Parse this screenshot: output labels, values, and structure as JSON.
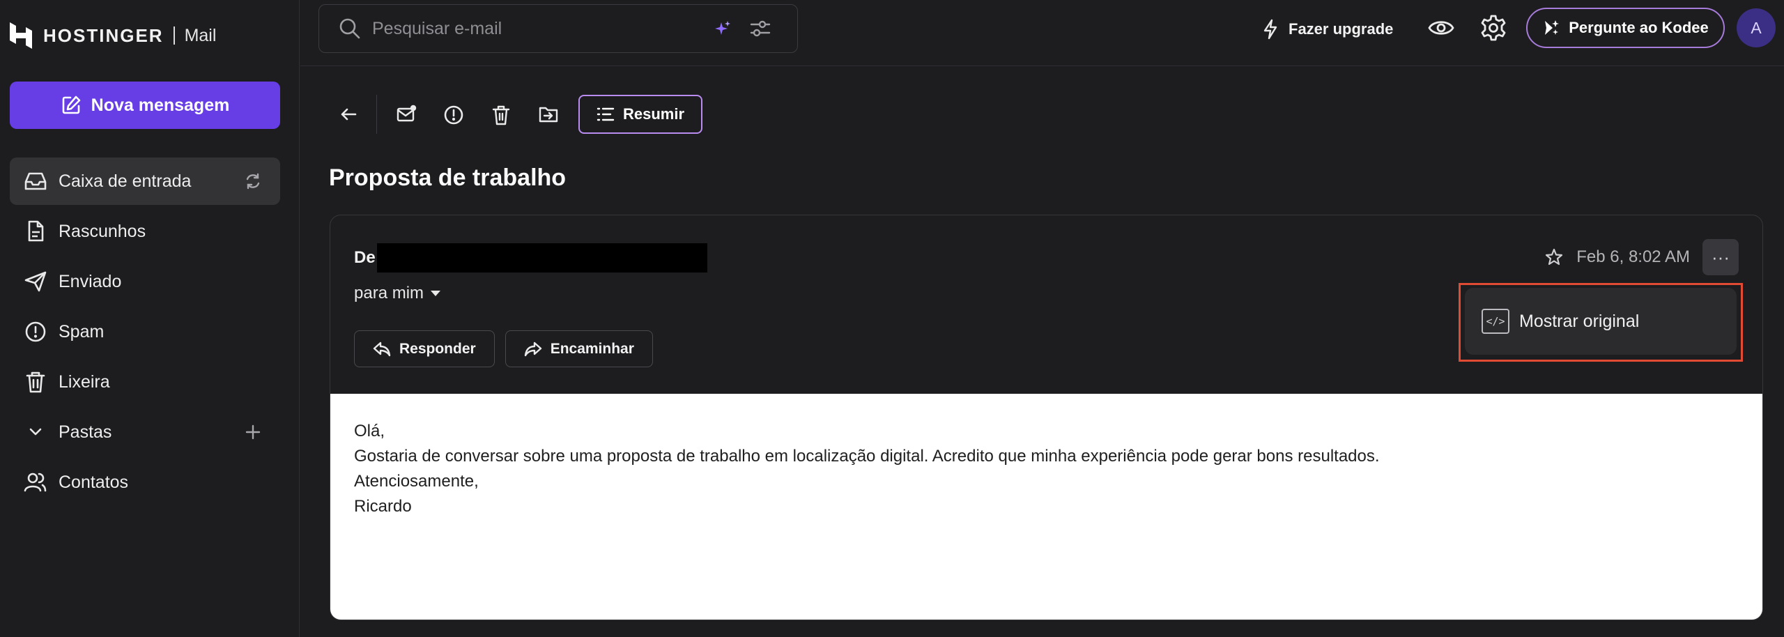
{
  "brand": {
    "name": "HOSTINGER",
    "product": "Mail"
  },
  "compose": {
    "label": "Nova mensagem"
  },
  "sidebar": {
    "items": [
      {
        "label": "Caixa de entrada",
        "icon": "inbox-icon"
      },
      {
        "label": "Rascunhos",
        "icon": "draft-icon"
      },
      {
        "label": "Enviado",
        "icon": "send-icon"
      },
      {
        "label": "Spam",
        "icon": "spam-icon"
      },
      {
        "label": "Lixeira",
        "icon": "trash-icon"
      },
      {
        "label": "Pastas",
        "icon": "chevron-down-icon"
      },
      {
        "label": "Contatos",
        "icon": "contacts-icon"
      }
    ]
  },
  "search": {
    "placeholder": "Pesquisar e-mail"
  },
  "topbar": {
    "upgrade_label": "Fazer upgrade",
    "kodee_label": "Pergunte ao Kodee",
    "avatar_initial": "A"
  },
  "toolbar": {
    "summarize_label": "Resumir"
  },
  "message": {
    "subject": "Proposta de trabalho",
    "from_label": "De",
    "to_label": "para mim",
    "date": "Feb 6, 8:02 AM",
    "more": "···",
    "reply_label": "Responder",
    "forward_label": "Encaminhar",
    "body": [
      "Olá,",
      "Gostaria de conversar sobre uma proposta de trabalho em localização digital. Acredito que minha experiência pode gerar bons resultados.",
      "Atenciosamente,",
      "Ricardo"
    ]
  },
  "dropdown": {
    "show_original_label": "Mostrar original",
    "code_glyph": "</>"
  },
  "colors": {
    "accent": "#673de6",
    "background": "#1d1d1f",
    "highlight_border": "#e24b33"
  }
}
